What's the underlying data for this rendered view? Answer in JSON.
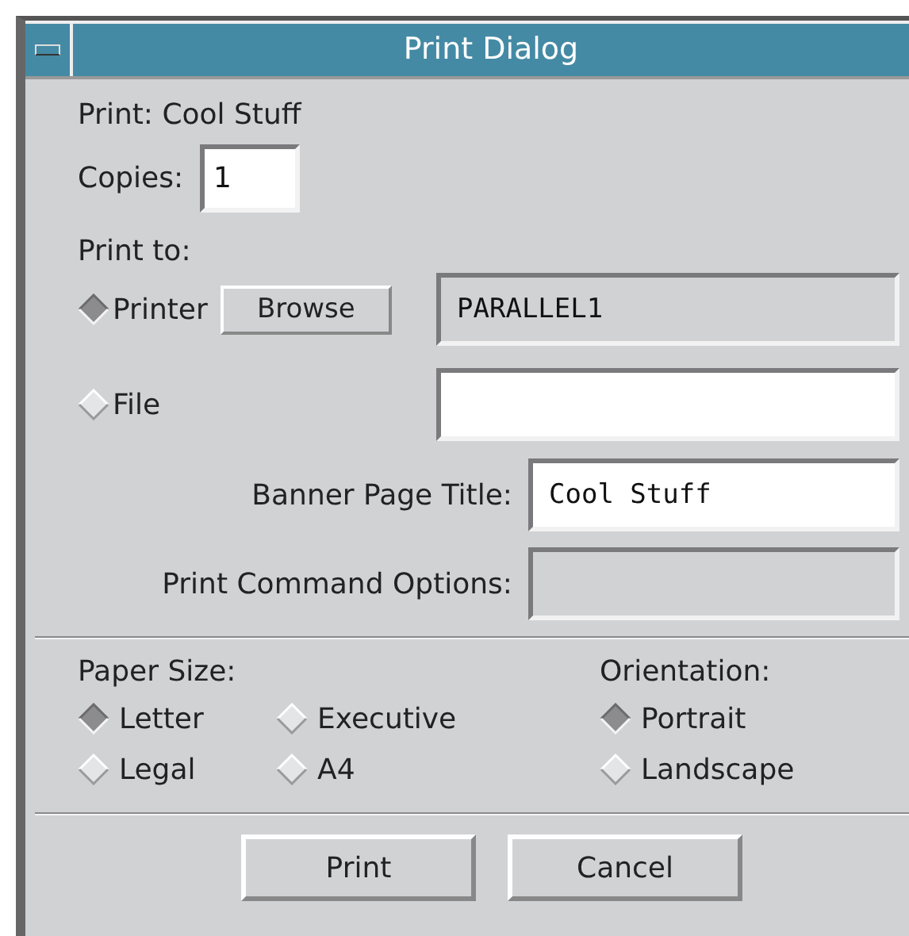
{
  "window": {
    "title": "Print Dialog"
  },
  "document_line": "Print: Cool Stuff",
  "copies": {
    "label": "Copies:",
    "value": "1"
  },
  "print_to": {
    "label": "Print to:",
    "destinations": [
      {
        "kind": "printer",
        "label": "Printer",
        "selected": true,
        "button": "Browse",
        "value": "PARALLEL1",
        "disabled": true
      },
      {
        "kind": "file",
        "label": "File",
        "selected": false,
        "disabled": false
      }
    ]
  },
  "options": [
    {
      "label": "Banner Page Title:",
      "value": "Cool Stuff",
      "disabled": false
    },
    {
      "label": "Print Command Options:",
      "disabled": true
    }
  ],
  "paper_size": {
    "label": "Paper Size:",
    "options": [
      {
        "label": "Letter",
        "selected": true
      },
      {
        "label": "Executive",
        "selected": false
      },
      {
        "label": "Legal",
        "selected": false
      },
      {
        "label": "A4",
        "selected": false
      }
    ]
  },
  "orientation": {
    "label": "Orientation:",
    "options": [
      {
        "label": "Portrait",
        "selected": true
      },
      {
        "label": "Landscape",
        "selected": false
      }
    ]
  },
  "buttons": [
    "Print",
    "Cancel"
  ]
}
